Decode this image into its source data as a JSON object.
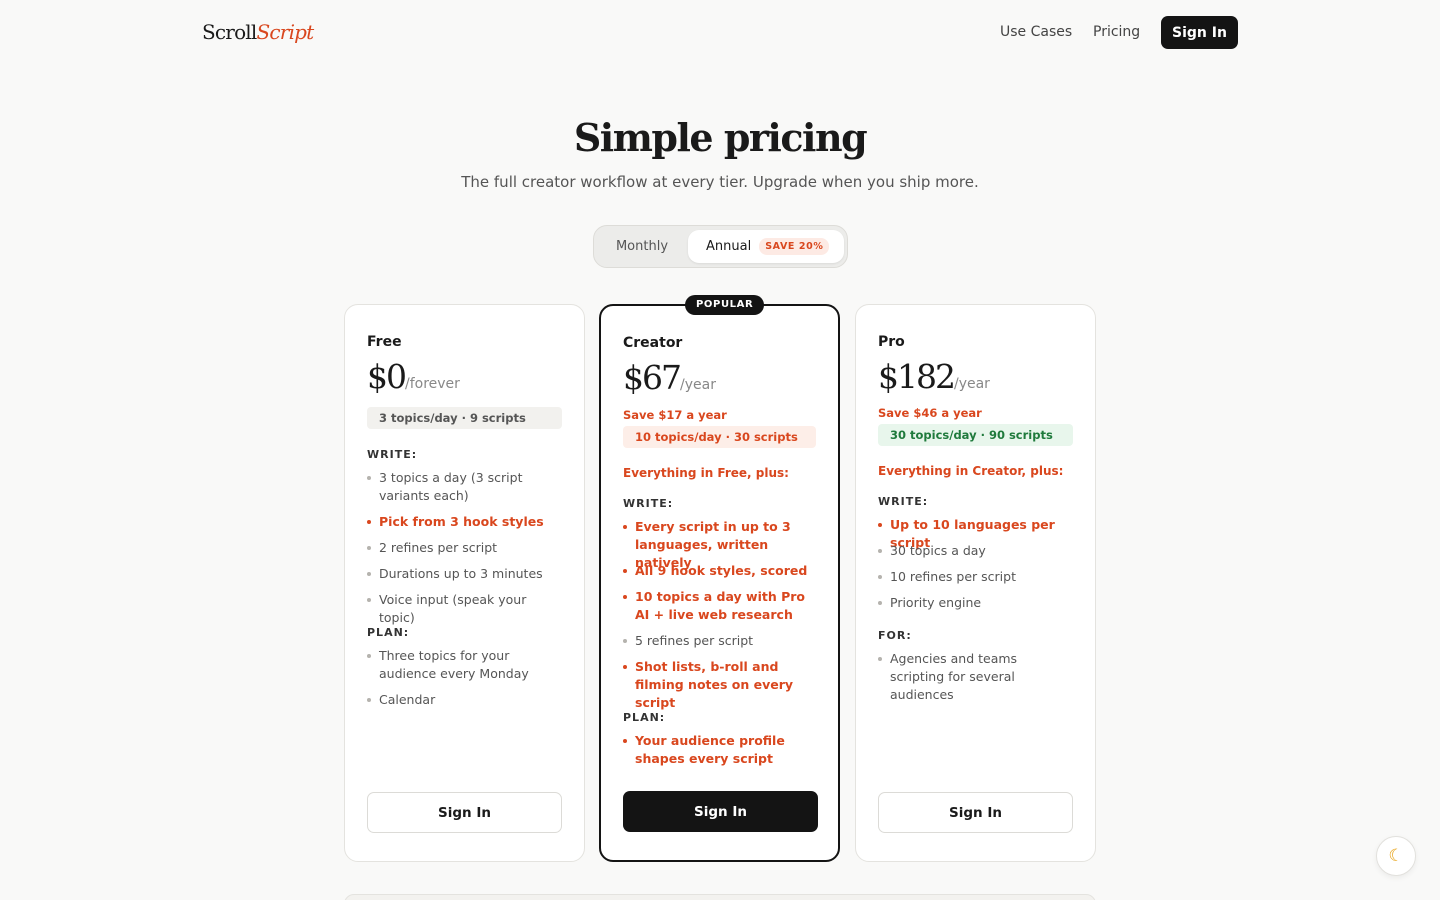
{
  "header": {
    "logo_plain": "Scroll",
    "logo_accent": "Script",
    "nav": [
      "Use Cases",
      "Pricing"
    ],
    "signin_label": "Sign In"
  },
  "hero": {
    "title": "Simple pricing",
    "subtitle": "The full creator workflow at every tier. Upgrade when you ship more."
  },
  "billing": {
    "monthly_label": "Monthly",
    "annual_label": "Annual",
    "annual_badge": "SAVE 20%",
    "selected": "Annual"
  },
  "plans": {
    "free": {
      "name": "Free",
      "price": "$0",
      "period": "/forever",
      "quota": "3 topics/day · 9 scripts",
      "sections": [
        {
          "label": "WRITE:",
          "items": [
            {
              "text": "3 topics a day (3 script variants each)",
              "highlight": false
            },
            {
              "text": "Pick from 3 hook styles",
              "highlight": true
            },
            {
              "text": "2 refines per script",
              "highlight": false
            },
            {
              "text": "Durations up to 3 minutes",
              "highlight": false
            },
            {
              "text": "Voice input (speak your topic)",
              "highlight": false
            }
          ]
        },
        {
          "label": "PLAN:",
          "items": [
            {
              "text": "Three topics for your audience every Monday",
              "highlight": false
            },
            {
              "text": "Calendar",
              "highlight": false
            }
          ]
        }
      ],
      "cta": "Sign In"
    },
    "creator": {
      "badge": "POPULAR",
      "name": "Creator",
      "price": "$67",
      "period": "/year",
      "save_note": "Save $17 a year",
      "quota": "10 topics/day · 30 scripts",
      "includes": "Everything in Free, plus:",
      "sections": [
        {
          "label": "WRITE:",
          "items": [
            {
              "text": "Every script in up to 3 languages, written natively",
              "highlight": true
            },
            {
              "text": "All 9 hook styles, scored",
              "highlight": true
            },
            {
              "text": "10 topics a day with Pro AI + live web research",
              "highlight": true
            },
            {
              "text": "5 refines per script",
              "highlight": false
            },
            {
              "text": "Shot lists, b-roll and filming notes on every script",
              "highlight": true
            }
          ]
        },
        {
          "label": "PLAN:",
          "items": [
            {
              "text": "Your audience profile shapes every script",
              "highlight": true
            }
          ]
        }
      ],
      "cta": "Sign In"
    },
    "pro": {
      "name": "Pro",
      "price": "$182",
      "period": "/year",
      "save_note": "Save $46 a year",
      "quota": "30 topics/day · 90 scripts",
      "includes": "Everything in Creator, plus:",
      "sections": [
        {
          "label": "WRITE:",
          "items": [
            {
              "text": "Up to 10 languages per script",
              "highlight": true
            },
            {
              "text": "30 topics a day",
              "highlight": false
            },
            {
              "text": "10 refines per script",
              "highlight": false
            },
            {
              "text": "Priority engine",
              "highlight": false
            }
          ]
        },
        {
          "label": "FOR:",
          "items": [
            {
              "text": "Agencies and teams scripting for several audiences",
              "highlight": false
            }
          ]
        }
      ],
      "cta": "Sign In"
    }
  },
  "theme_toggle_icon": "moon-icon",
  "colors": {
    "accent": "#d9471e",
    "dark": "#141414",
    "success": "#1f7a3c"
  }
}
